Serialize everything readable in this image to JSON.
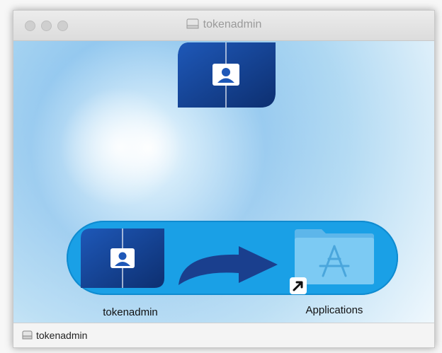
{
  "window": {
    "title": "tokenadmin"
  },
  "installer": {
    "app_label": "tokenadmin",
    "applications_label": "Applications"
  },
  "status_bar": {
    "label": "tokenadmin"
  },
  "colors": {
    "pill": "#1aa0e6",
    "icon_dark": "#123d8a",
    "folder": "#6fc2f0"
  }
}
